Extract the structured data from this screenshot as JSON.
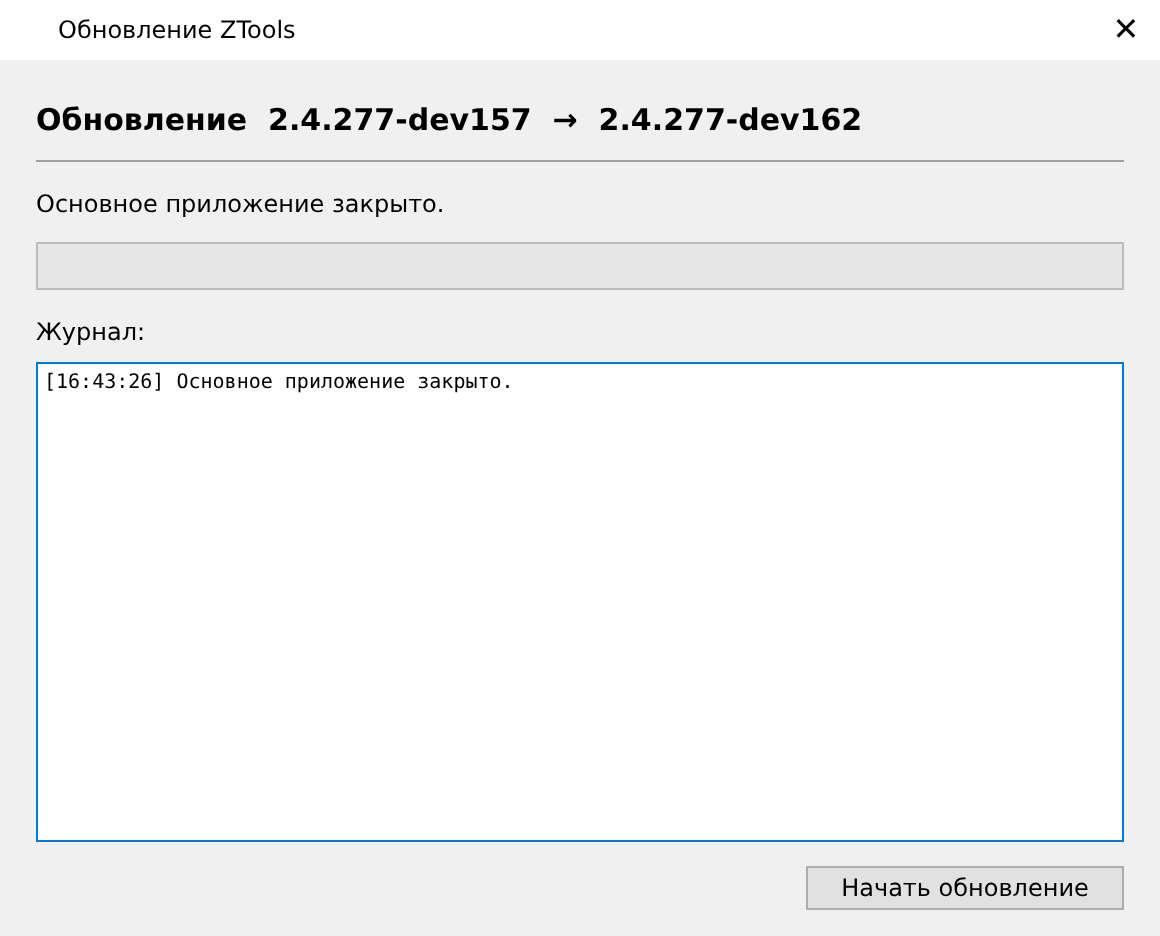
{
  "window": {
    "title": "Обновление ZTools",
    "close": "✕"
  },
  "heading": "Обновление  2.4.277-dev157  →  2.4.277-dev162",
  "status": "Основное приложение закрыто.",
  "progress": {
    "level": 0
  },
  "log": {
    "label": "Журнал:",
    "lines": [
      "[16:43:26] Основное приложение закрыто."
    ]
  },
  "button": "Начать обновление"
}
